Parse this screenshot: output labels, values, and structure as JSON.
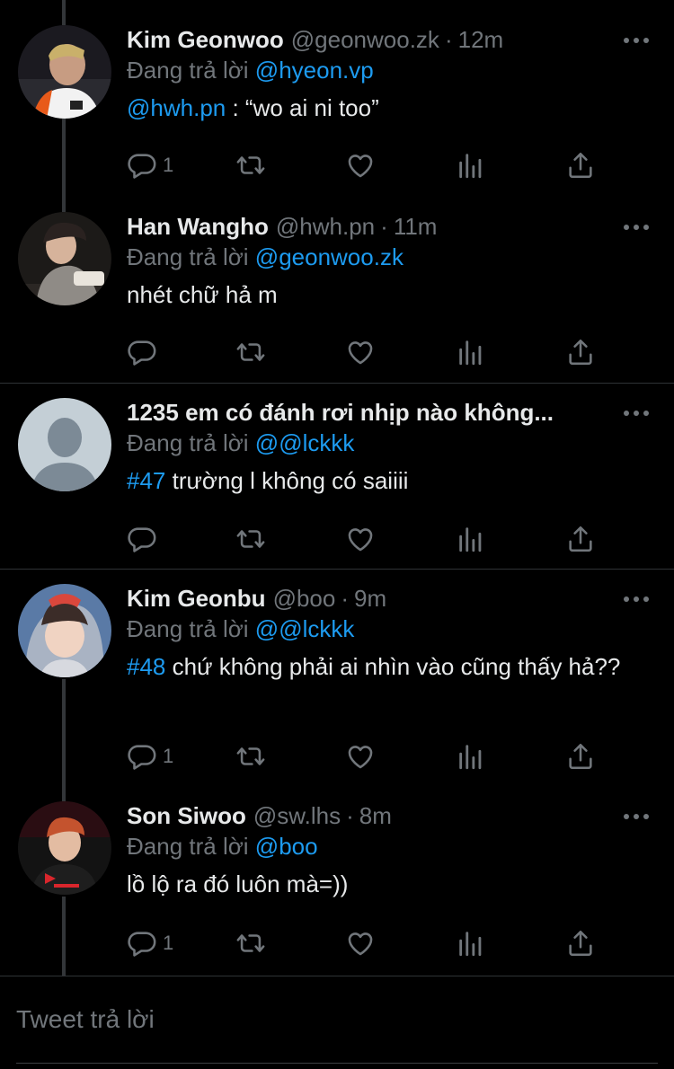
{
  "reply_prefix": "Đang trả lời",
  "tweets": [
    {
      "name": "Kim Geonwoo",
      "handle": "@geonwoo.zk",
      "separator": "·",
      "time": "12m",
      "reply_to": "@hyeon.vp",
      "body_mention": "@hwh.pn",
      "body_text": " : “wo ai ni too”",
      "reply_count": "1"
    },
    {
      "name": "Han Wangho",
      "handle": "@hwh.pn",
      "separator": "·",
      "time": "11m",
      "reply_to": "@geonwoo.zk",
      "body_text": "nhét chữ hả m",
      "reply_count": ""
    },
    {
      "name": "1235 em có đánh rơi nhịp nào không...",
      "reply_to": "@@lckkk",
      "body_tag": "#47",
      "body_text": " trường l không có saiiii",
      "reply_count": ""
    },
    {
      "name": "Kim Geonbu",
      "handle": "@boo",
      "separator": "·",
      "time": "9m",
      "reply_to": "@@lckkk",
      "body_tag": "#48",
      "body_text": " chứ không phải ai nhìn vào cũng thấy hả??",
      "reply_count": "1"
    },
    {
      "name": "Son Siwoo",
      "handle": "@sw.lhs",
      "separator": "·",
      "time": "8m",
      "reply_to": "@boo",
      "body_text": "lồ lộ ra đó luôn mà=))",
      "reply_count": "1"
    }
  ],
  "compose": {
    "placeholder": "Tweet trả lời"
  },
  "colors": {
    "background": "#000000",
    "text": "#e7e9ea",
    "muted": "#71767b",
    "link": "#1d9bf0",
    "divider": "#2f3336"
  },
  "icons": [
    "reply-icon",
    "retweet-icon",
    "like-icon",
    "analytics-icon",
    "share-icon",
    "more-icon"
  ]
}
